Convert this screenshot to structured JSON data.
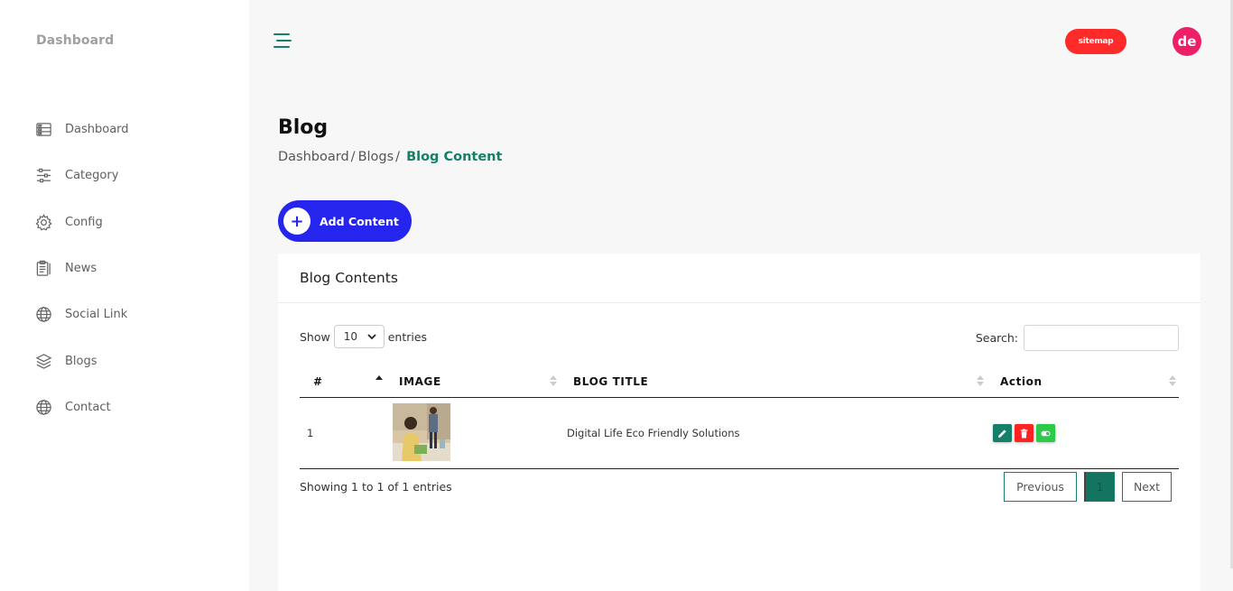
{
  "sidebar": {
    "brand": "Dashboard",
    "items": [
      {
        "label": "Dashboard",
        "icon": "dashboard-icon"
      },
      {
        "label": "Category",
        "icon": "sliders-icon"
      },
      {
        "label": "Config",
        "icon": "gear-icon"
      },
      {
        "label": "News",
        "icon": "clipboard-icon"
      },
      {
        "label": "Social Link",
        "icon": "globe-icon"
      },
      {
        "label": "Blogs",
        "icon": "layers-icon"
      },
      {
        "label": "Contact",
        "icon": "globe-icon"
      }
    ]
  },
  "header": {
    "sitemap_label": "sitemap",
    "avatar_initials": "de",
    "sitemap_color": "#ff2a2a",
    "avatar_color": "#ec1f67"
  },
  "page": {
    "title": "Blog",
    "breadcrumb": [
      "Dashboard",
      "Blogs",
      "Blog Content"
    ],
    "breadcrumb_separator": "/",
    "add_button_label": "Add Content",
    "add_button_icon": "plus-icon",
    "accent_color": "#15806a",
    "add_button_color": "#2525ee"
  },
  "card": {
    "title": "Blog Contents",
    "show_label": "Show",
    "entries_label": "entries",
    "page_size": "10",
    "search_label": "Search:",
    "search_value": "",
    "columns": [
      "#",
      "IMAGE",
      "BLOG TITLE",
      "Action"
    ],
    "rows": [
      {
        "num": "1",
        "image": "photo of woman and child in kitchen",
        "title": "Digital Life Eco Friendly Solutions"
      }
    ],
    "info": "Showing 1 to 1 of 1 entries",
    "pagination": {
      "previous": "Previous",
      "current": "1",
      "next": "Next"
    }
  }
}
